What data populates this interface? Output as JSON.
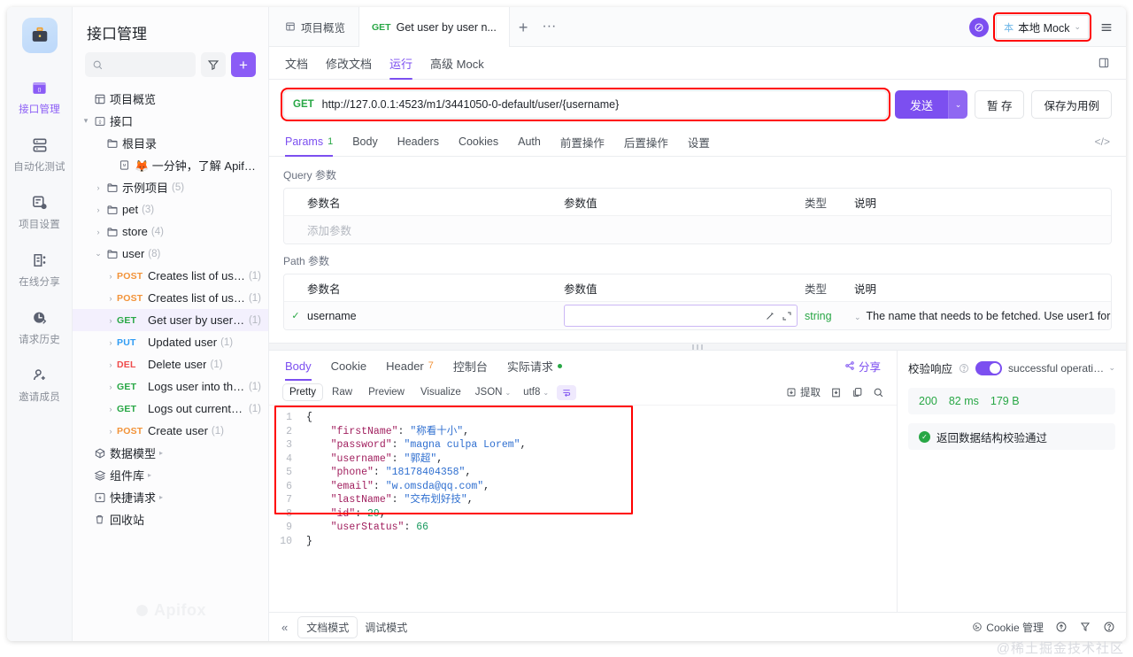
{
  "rail": {
    "logo_icon": "briefcase-icon",
    "items": [
      {
        "label": "接口管理",
        "icon": "api-manage-icon",
        "active": true
      },
      {
        "label": "自动化测试",
        "icon": "automation-test-icon",
        "active": false
      },
      {
        "label": "项目设置",
        "icon": "project-settings-icon",
        "active": false
      },
      {
        "label": "在线分享",
        "icon": "online-share-icon",
        "active": false
      },
      {
        "label": "请求历史",
        "icon": "request-history-icon",
        "active": false
      },
      {
        "label": "邀请成员",
        "icon": "invite-member-icon",
        "active": false
      }
    ]
  },
  "sidebar": {
    "title": "接口管理",
    "search_placeholder": "",
    "search_value": "",
    "filter_label": "筛选",
    "add_label": "+",
    "watermark": "Apifox",
    "tree": [
      {
        "label": "项目概览",
        "icon": "overview-icon",
        "indent": 0,
        "caret": "",
        "count": "",
        "method": ""
      },
      {
        "label": "接口",
        "icon": "api-icon",
        "indent": 0,
        "caret": "▾",
        "count": "",
        "method": ""
      },
      {
        "label": "根目录",
        "icon": "folder-icon",
        "indent": 1,
        "caret": "",
        "count": "",
        "method": ""
      },
      {
        "label": "🦊 一分钟，了解 Apifox！",
        "icon": "markdown-icon",
        "indent": 2,
        "caret": "",
        "count": "",
        "method": ""
      },
      {
        "label": "示例项目",
        "icon": "folder-icon",
        "indent": 1,
        "caret": "›",
        "count": "(5)",
        "method": ""
      },
      {
        "label": "pet",
        "icon": "folder-icon",
        "indent": 1,
        "caret": "›",
        "count": "(3)",
        "method": ""
      },
      {
        "label": "store",
        "icon": "folder-icon",
        "indent": 1,
        "caret": "›",
        "count": "(4)",
        "method": ""
      },
      {
        "label": "user",
        "icon": "folder-icon",
        "indent": 1,
        "caret": "⌄",
        "count": "(8)",
        "method": ""
      },
      {
        "label": "Creates list of use...",
        "icon": "",
        "indent": 2,
        "caret": "›",
        "count": "(1)",
        "method": "POST"
      },
      {
        "label": "Creates list of use...",
        "icon": "",
        "indent": 2,
        "caret": "›",
        "count": "(1)",
        "method": "POST"
      },
      {
        "label": "Get user by user ...",
        "icon": "",
        "indent": 2,
        "caret": "›",
        "count": "(1)",
        "method": "GET",
        "selected": true
      },
      {
        "label": "Updated user",
        "icon": "",
        "indent": 2,
        "caret": "›",
        "count": "(1)",
        "method": "PUT"
      },
      {
        "label": "Delete user",
        "icon": "",
        "indent": 2,
        "caret": "›",
        "count": "(1)",
        "method": "DEL"
      },
      {
        "label": "Logs user into the...",
        "icon": "",
        "indent": 2,
        "caret": "›",
        "count": "(1)",
        "method": "GET"
      },
      {
        "label": "Logs out current l...",
        "icon": "",
        "indent": 2,
        "caret": "›",
        "count": "(1)",
        "method": "GET"
      },
      {
        "label": "Create user",
        "icon": "",
        "indent": 2,
        "caret": "›",
        "count": "(1)",
        "method": "POST"
      },
      {
        "label": "数据模型",
        "icon": "data-model-icon",
        "indent": 0,
        "caret": "",
        "count": "",
        "method": "",
        "trail": "▸"
      },
      {
        "label": "组件库",
        "icon": "component-library-icon",
        "indent": 0,
        "caret": "",
        "count": "",
        "method": "",
        "trail": "▸"
      },
      {
        "label": "快捷请求",
        "icon": "quick-request-icon",
        "indent": 0,
        "caret": "",
        "count": "",
        "method": "",
        "trail": "▸"
      },
      {
        "label": "回收站",
        "icon": "trash-icon",
        "indent": 0,
        "caret": "",
        "count": "",
        "method": ""
      }
    ]
  },
  "tabbar": {
    "tabs": [
      {
        "label": "项目概览",
        "icon": "overview-icon",
        "method": "",
        "active": false
      },
      {
        "label": "Get user by user n...",
        "icon": "",
        "method": "GET",
        "active": true
      }
    ],
    "new_tab_label": "+",
    "more_label": "···",
    "sync_icon": "sync-circle-icon",
    "env_badge": "本",
    "env_label": "本地 Mock",
    "env_caret": "⌄",
    "menu_icon": "hamburger-icon"
  },
  "subtabs": {
    "items": [
      {
        "label": "文档",
        "active": false
      },
      {
        "label": "修改文档",
        "active": false
      },
      {
        "label": "运行",
        "active": true
      },
      {
        "label": "高级 Mock",
        "active": false
      }
    ],
    "right_icon": "side-panel-icon"
  },
  "urlbar": {
    "method": "GET",
    "url": "http://127.0.0.1:4523/m1/3441050-0-default/user/{username}",
    "send_label": "发送",
    "send_caret": "⌄",
    "save_draft_label": "暂 存",
    "save_case_label": "保存为用例",
    "highlighted": true
  },
  "param_tabs": {
    "items": [
      {
        "label": "Params",
        "badge": "1",
        "active": true
      },
      {
        "label": "Body",
        "badge": "",
        "active": false
      },
      {
        "label": "Headers",
        "badge": "",
        "active": false
      },
      {
        "label": "Cookies",
        "badge": "",
        "active": false
      },
      {
        "label": "Auth",
        "badge": "",
        "active": false
      },
      {
        "label": "前置操作",
        "badge": "",
        "active": false
      },
      {
        "label": "后置操作",
        "badge": "",
        "active": false
      },
      {
        "label": "设置",
        "badge": "",
        "active": false
      }
    ],
    "code_icon": "code-brackets-icon"
  },
  "query_params": {
    "section_label": "Query 参数",
    "headers": [
      "参数名",
      "参数值",
      "类型",
      "说明"
    ],
    "add_placeholder": "添加参数"
  },
  "path_params": {
    "section_label": "Path 参数",
    "headers": [
      "参数名",
      "参数值",
      "类型",
      "说明"
    ],
    "rows": [
      {
        "checked": "✓",
        "name": "username",
        "value": "",
        "type": "string",
        "desc": "The name that needs to be fetched. Use user1 for",
        "icon_magic": "magic-wand-icon",
        "icon_expand": "expand-icon"
      }
    ]
  },
  "response": {
    "tabs": [
      {
        "label": "Body",
        "badge": "",
        "dot": false,
        "active": true
      },
      {
        "label": "Cookie",
        "badge": "",
        "dot": false,
        "active": false
      },
      {
        "label": "Header",
        "badge": "7",
        "dot": false,
        "active": false
      },
      {
        "label": "控制台",
        "badge": "",
        "dot": false,
        "active": false
      },
      {
        "label": "实际请求",
        "badge": "",
        "dot": true,
        "active": false
      }
    ],
    "share_label": "分享",
    "share_icon": "share-icon",
    "toolbar": {
      "segments": [
        {
          "label": "Pretty",
          "on": true
        },
        {
          "label": "Raw",
          "on": false
        },
        {
          "label": "Preview",
          "on": false
        },
        {
          "label": "Visualize",
          "on": false
        }
      ],
      "format": "JSON",
      "encoding": "utf8",
      "wrap_icon": "word-wrap-icon",
      "extract_label": "提取",
      "extract_icon": "extract-icon",
      "save_icon": "save-download-icon",
      "copy_icon": "copy-icon",
      "search_icon": "search-icon"
    },
    "json_lines": [
      {
        "n": "1",
        "text": "{"
      },
      {
        "n": "2",
        "text": "    \"firstName\": \"称看十小\","
      },
      {
        "n": "3",
        "text": "    \"password\": \"magna culpa Lorem\","
      },
      {
        "n": "4",
        "text": "    \"username\": \"郭超\","
      },
      {
        "n": "5",
        "text": "    \"phone\": \"18178404358\","
      },
      {
        "n": "6",
        "text": "    \"email\": \"w.omsda@qq.com\","
      },
      {
        "n": "7",
        "text": "    \"lastName\": \"交布划好技\","
      },
      {
        "n": "8",
        "text": "    \"id\": 29,"
      },
      {
        "n": "9",
        "text": "    \"userStatus\": 66"
      },
      {
        "n": "10",
        "text": "}"
      }
    ],
    "json_body": {
      "firstName": "称看十小",
      "password": "magna culpa Lorem",
      "username": "郭超",
      "phone": "18178404358",
      "email": "w.omsda@qq.com",
      "lastName": "交布划好技",
      "id": 29,
      "userStatus": 66
    },
    "highlighted": true
  },
  "validation": {
    "label": "校验响应",
    "help_icon": "question-circle-icon",
    "toggle_on": true,
    "selected_response": "successful operation (...",
    "status_code": "200",
    "time": "82 ms",
    "size": "179 B",
    "result_text": "返回数据结构校验通过",
    "result_icon": "check-circle-icon"
  },
  "footer": {
    "collapse_icon": "collapse-left-icon",
    "modes": [
      {
        "label": "文档模式",
        "on": true
      },
      {
        "label": "调试模式",
        "on": false
      }
    ],
    "cookie_label": "Cookie 管理",
    "cookie_icon": "cookie-icon",
    "up_icon": "upload-circle-icon",
    "funnel_icon": "funnel-icon",
    "help_icon": "help-circle-icon"
  },
  "watermark": "@稀土掘金技术社区",
  "colors": {
    "accent": "#7c4ff0",
    "get": "#28a745",
    "post": "#f29339",
    "put": "#2f9cf4",
    "delete": "#ef4b4b",
    "highlight_box": "#ff0000"
  }
}
